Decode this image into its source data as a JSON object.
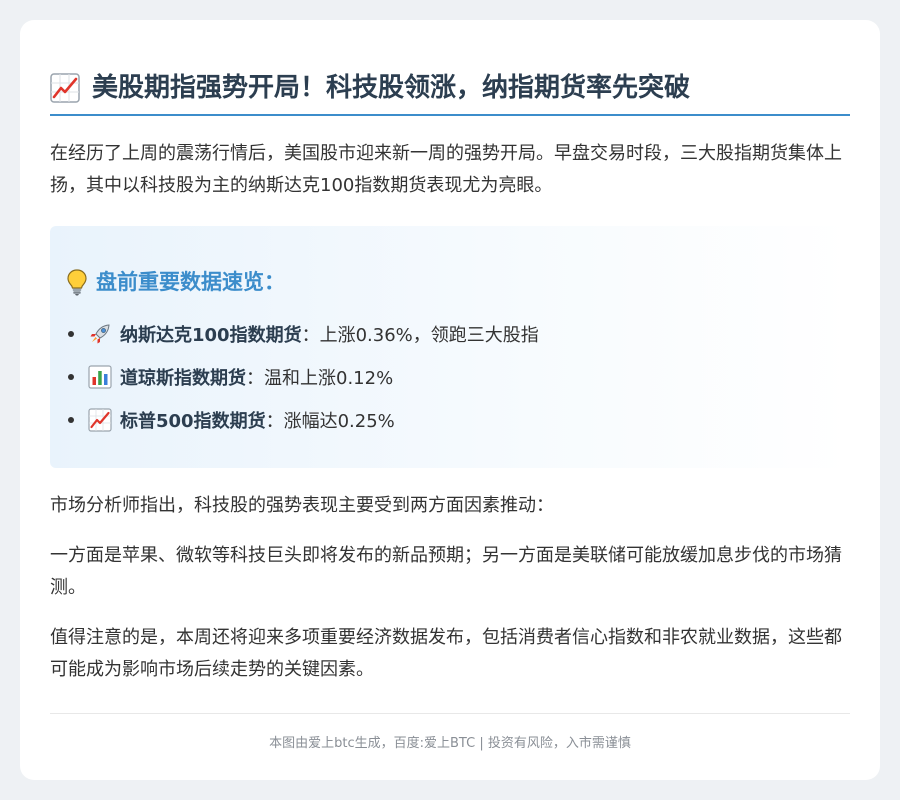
{
  "article": {
    "title": "美股期指强势开局！科技股领涨，纳指期货率先突破",
    "title_icon": "chart-increasing-icon",
    "intro": "在经历了上周的震荡行情后，美国股市迎来新一周的强势开局。早盘交易时段，三大股指期货集体上扬，其中以科技股为主的纳斯达克100指数期货表现尤为亮眼。",
    "highlight": {
      "icon": "light-bulb-icon",
      "title": "盘前重要数据速览：",
      "items": [
        {
          "icon": "rocket-icon",
          "label": "纳斯达克100指数期货",
          "sep": "：",
          "text": "上涨0.36%，领跑三大股指"
        },
        {
          "icon": "bar-chart-icon",
          "label": "道琼斯指数期货",
          "sep": "：",
          "text": "温和上涨0.12%"
        },
        {
          "icon": "chart-increasing-icon",
          "label": "标普500指数期货",
          "sep": "：",
          "text": "涨幅达0.25%"
        }
      ]
    },
    "paragraphs": [
      "市场分析师指出，科技股的强势表现主要受到两方面因素推动：",
      "一方面是苹果、微软等科技巨头即将发布的新品预期；另一方面是美联储可能放缓加息步伐的市场猜测。",
      "值得注意的是，本周还将迎来多项重要经济数据发布，包括消费者信心指数和非农就业数据，这些都可能成为影响市场后续走势的关键因素。"
    ],
    "footer": "本图由爱上btc生成，百度:爱上BTC | 投资有风险，入市需谨慎"
  },
  "colors": {
    "accent": "#3c8dcb",
    "title": "#2c3e50",
    "text": "#333333",
    "footer": "#8a8f96"
  }
}
